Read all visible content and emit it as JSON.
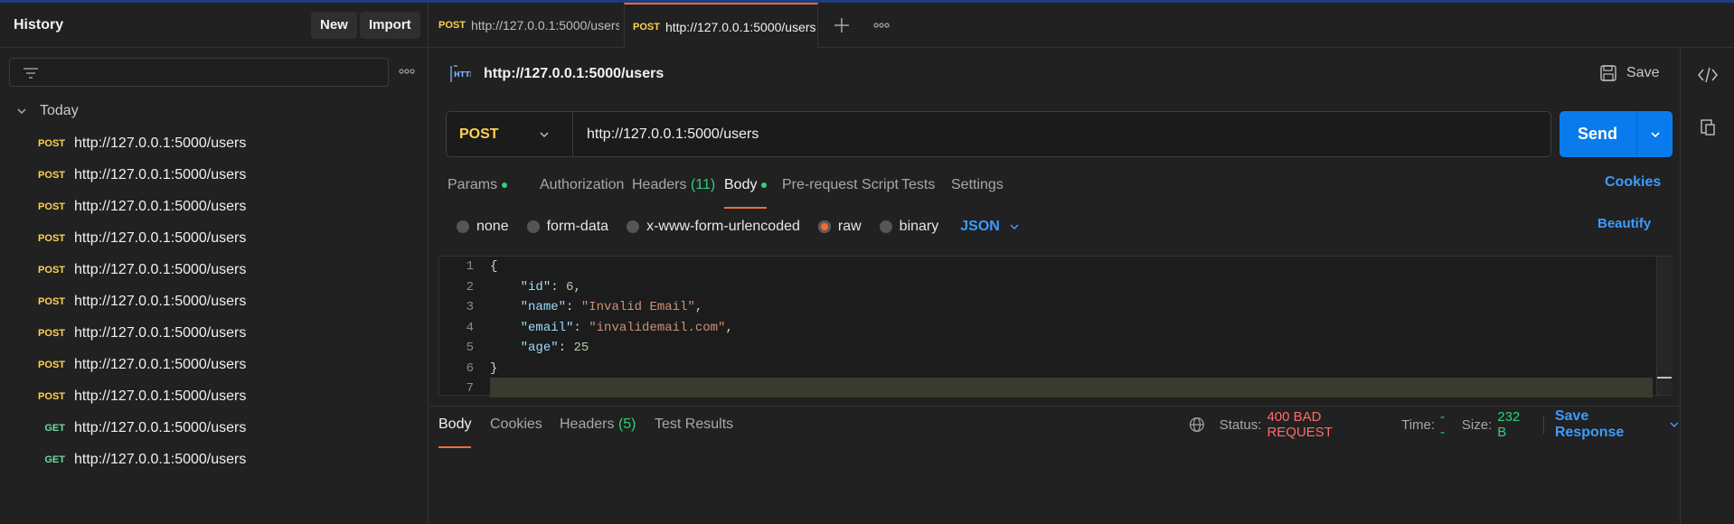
{
  "sidebar": {
    "title": "History",
    "new_label": "New",
    "import_label": "Import",
    "group_label": "Today",
    "items": [
      {
        "method": "POST",
        "url": "http://127.0.0.1:5000/users"
      },
      {
        "method": "POST",
        "url": "http://127.0.0.1:5000/users"
      },
      {
        "method": "POST",
        "url": "http://127.0.0.1:5000/users"
      },
      {
        "method": "POST",
        "url": "http://127.0.0.1:5000/users"
      },
      {
        "method": "POST",
        "url": "http://127.0.0.1:5000/users"
      },
      {
        "method": "POST",
        "url": "http://127.0.0.1:5000/users"
      },
      {
        "method": "POST",
        "url": "http://127.0.0.1:5000/users"
      },
      {
        "method": "POST",
        "url": "http://127.0.0.1:5000/users"
      },
      {
        "method": "POST",
        "url": "http://127.0.0.1:5000/users"
      },
      {
        "method": "GET",
        "url": "http://127.0.0.1:5000/users"
      },
      {
        "method": "GET",
        "url": "http://127.0.0.1:5000/users"
      }
    ]
  },
  "tabs": [
    {
      "method": "POST",
      "label": "http://127.0.0.1:5000/users"
    },
    {
      "method": "POST",
      "label": "http://127.0.0.1:5000/users"
    }
  ],
  "request": {
    "title": "http://127.0.0.1:5000/users",
    "save_label": "Save",
    "method": "POST",
    "url": "http://127.0.0.1:5000/users",
    "send_label": "Send"
  },
  "request_tabs": {
    "params": "Params",
    "authorization": "Authorization",
    "headers": "Headers",
    "headers_count": "(11)",
    "body": "Body",
    "prerequest": "Pre-request Script",
    "tests": "Tests",
    "settings": "Settings",
    "cookies": "Cookies"
  },
  "body_options": {
    "none": "none",
    "form_data": "form-data",
    "urlencoded": "x-www-form-urlencoded",
    "raw": "raw",
    "binary": "binary",
    "format": "JSON",
    "beautify": "Beautify"
  },
  "editor": {
    "line_numbers": [
      "1",
      "2",
      "3",
      "4",
      "5",
      "6",
      "7"
    ],
    "l1": "{",
    "l2_key": "\"id\"",
    "l2_val": "6",
    "l3_key": "\"name\"",
    "l3_val": "\"Invalid Email\"",
    "l4_key": "\"email\"",
    "l4_val": "\"invalidemail.com\"",
    "l5_key": "\"age\"",
    "l5_val": "25",
    "l6": "}"
  },
  "response": {
    "tab_body": "Body",
    "tab_cookies": "Cookies",
    "tab_headers": "Headers",
    "headers_count": "(5)",
    "tab_tests": "Test Results",
    "status_label": "Status:",
    "status_value": "400 BAD REQUEST",
    "time_label": "Time:",
    "time_value": "--",
    "size_label": "Size:",
    "size_value": "232 B",
    "save_response": "Save Response"
  },
  "colors": {
    "post": "#ffd24d",
    "get": "#6bdd9a",
    "accent": "#f26b3a",
    "send": "#097bed",
    "link": "#3b9cff",
    "error": "#ff6b6b",
    "ok": "#2fd07a"
  }
}
